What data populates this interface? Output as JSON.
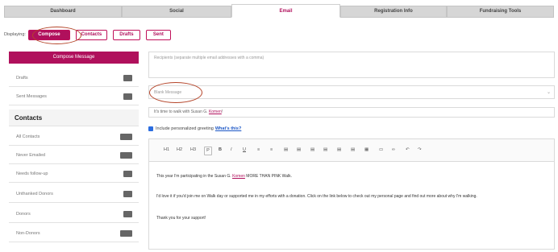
{
  "top_tabs": [
    "Dashboard",
    "Social",
    "Email",
    "Registration Info",
    "Fundraising Tools"
  ],
  "subnav": {
    "label": "Displaying:",
    "buttons": [
      "Compose",
      "Contacts",
      "Drafts",
      "Sent"
    ]
  },
  "sidebar": {
    "compose_button": "Compose Message",
    "items_top": [
      "Drafts",
      "Sent Messages"
    ],
    "contacts_heading": "Contacts",
    "contacts": [
      "All Contacts",
      "Never Emailed",
      "Needs follow-up",
      "Unthanked Donors",
      "Donors",
      "Non-Donors"
    ]
  },
  "compose": {
    "recipients_placeholder": "Recipients (separate multiple email addresses with a comma)",
    "template_select": "Blank Message",
    "subject_prefix": "It's time to walk with Susan G.",
    "subject_link": "Komen",
    "subject_suffix": "!",
    "greeting_label": "Include personalized greeting",
    "greeting_link": "What's this?"
  },
  "toolbar": [
    "H1",
    "H2",
    "H3",
    "P",
    "B",
    "I",
    "U"
  ],
  "editor": {
    "line1_prefix": "This year I'm participating in the Susan G.",
    "line1_link": "Komen",
    "line1_suffix": "MORE THAN PINK Walk.",
    "line2": "I'd love it if you'd join me on Walk day or supported me in my efforts with a donation.  Click on the link below to check out my personal page and find out more about why I'm walking.",
    "line3": "Thank you for your support!"
  }
}
